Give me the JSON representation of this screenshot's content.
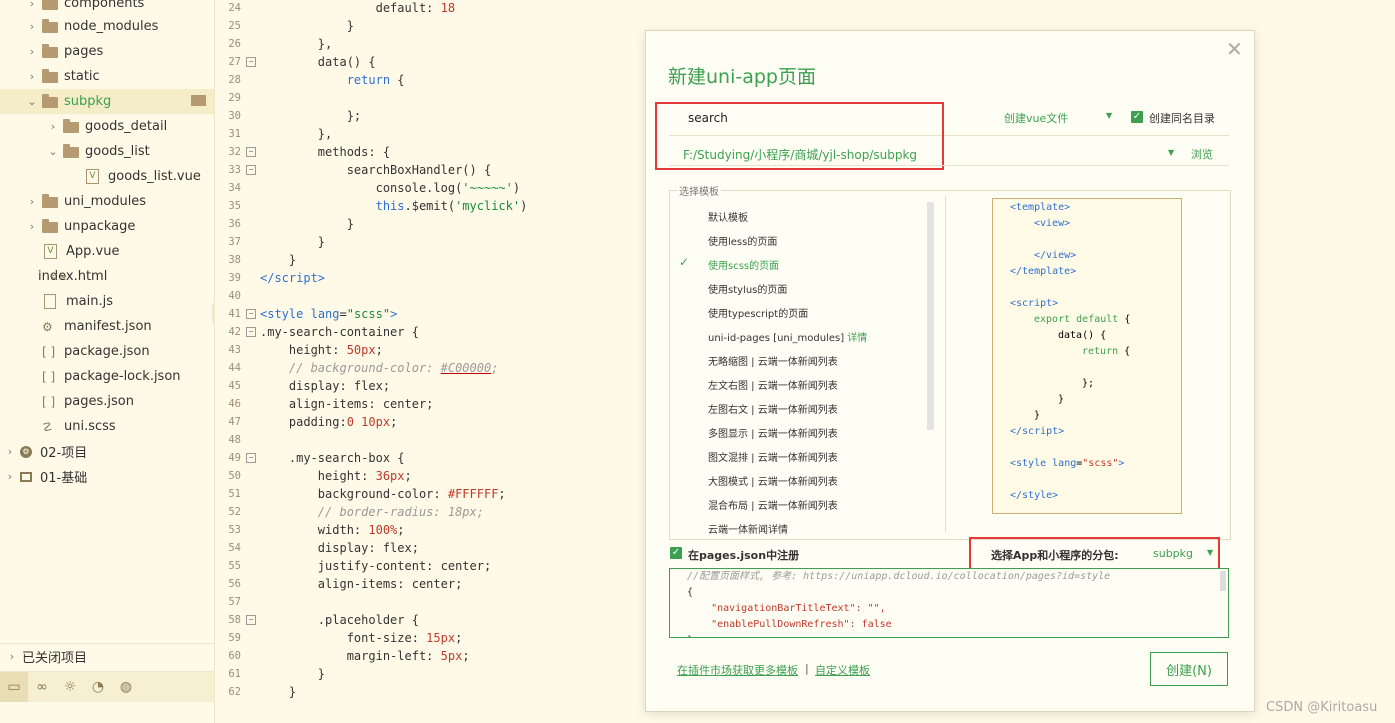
{
  "sidebar": {
    "items": [
      {
        "label": "components",
        "type": "folder",
        "depth": 1,
        "chevron": "›"
      },
      {
        "label": "node_modules",
        "type": "folder",
        "depth": 1,
        "chevron": "›"
      },
      {
        "label": "pages",
        "type": "folder",
        "depth": 1,
        "chevron": "›"
      },
      {
        "label": "static",
        "type": "folder",
        "depth": 1,
        "chevron": "›"
      },
      {
        "label": "subpkg",
        "type": "folder",
        "depth": 1,
        "chevron": "⌄",
        "selected": true
      },
      {
        "label": "goods_detail",
        "type": "folder",
        "depth": 2,
        "chevron": "›"
      },
      {
        "label": "goods_list",
        "type": "folder",
        "depth": 2,
        "chevron": "⌄"
      },
      {
        "label": "goods_list.vue",
        "type": "vue",
        "depth": 3,
        "chevron": ""
      },
      {
        "label": "uni_modules",
        "type": "folder",
        "depth": 1,
        "chevron": "›"
      },
      {
        "label": "unpackage",
        "type": "folder",
        "depth": 1,
        "chevron": "›"
      },
      {
        "label": "App.vue",
        "type": "vue",
        "depth": 1,
        "chevron": ""
      },
      {
        "label": "index.html",
        "type": "code",
        "depth": 1,
        "chevron": ""
      },
      {
        "label": "main.js",
        "type": "file",
        "depth": 1,
        "chevron": ""
      },
      {
        "label": "manifest.json",
        "type": "gear",
        "depth": 1,
        "chevron": ""
      },
      {
        "label": "package.json",
        "type": "brk",
        "depth": 1,
        "chevron": ""
      },
      {
        "label": "package-lock.json",
        "type": "brk",
        "depth": 1,
        "chevron": ""
      },
      {
        "label": "pages.json",
        "type": "brk",
        "depth": 1,
        "chevron": ""
      },
      {
        "label": "uni.scss",
        "type": "leaf",
        "depth": 1,
        "chevron": ""
      },
      {
        "label": "02-项目",
        "type": "proj",
        "depth": 0,
        "chevron": "›"
      },
      {
        "label": "01-基础",
        "type": "box",
        "depth": 0,
        "chevron": "›"
      }
    ],
    "closed_projects": "已关闭项目",
    "closed_chevron": "›"
  },
  "editor": {
    "lines": [
      {
        "n": "24",
        "html": "                default: <span class='num'>18</span>"
      },
      {
        "n": "25",
        "html": "            }"
      },
      {
        "n": "26",
        "html": "        },"
      },
      {
        "n": "27",
        "html": "        data() {",
        "fold": true
      },
      {
        "n": "28",
        "html": "            <span class='kw'>return</span> {"
      },
      {
        "n": "29",
        "html": ""
      },
      {
        "n": "30",
        "html": "            };"
      },
      {
        "n": "31",
        "html": "        },"
      },
      {
        "n": "32",
        "html": "        methods: {",
        "fold": true
      },
      {
        "n": "33",
        "html": "            searchBoxHandler() {",
        "fold": true
      },
      {
        "n": "34",
        "html": "                console.log(<span class='str'>'~~~~~'</span>)"
      },
      {
        "n": "35",
        "html": "                <span class='kw'>this</span>.$emit(<span class='str'>'myclick'</span>)"
      },
      {
        "n": "36",
        "html": "            }"
      },
      {
        "n": "37",
        "html": "        }"
      },
      {
        "n": "38",
        "html": "    }"
      },
      {
        "n": "39",
        "html": "<span class='tag'>&lt;/script&gt;</span>"
      },
      {
        "n": "40",
        "html": ""
      },
      {
        "n": "41",
        "html": "<span class='tag'>&lt;style</span> <span class='tag'>lang</span>=<span class='str'>\"scss\"</span><span class='tag'>&gt;</span>",
        "fold": true
      },
      {
        "n": "42",
        "html": ".my-search-container {",
        "fold": true
      },
      {
        "n": "43",
        "html": "    height: <span class='num'>50px</span>;"
      },
      {
        "n": "44",
        "html": "    <span class='cmt'>// background-color: <span style='text-decoration:underline;text-decoration-color:#c00000;'>#C00000</span>;</span>"
      },
      {
        "n": "45",
        "html": "    display: flex;"
      },
      {
        "n": "46",
        "html": "    align-items: center;"
      },
      {
        "n": "47",
        "html": "    padding:<span class='num'>0</span> <span class='num'>10px</span>;"
      },
      {
        "n": "48",
        "html": ""
      },
      {
        "n": "49",
        "html": "    .my-search-box {",
        "fold": true
      },
      {
        "n": "50",
        "html": "        height: <span class='num'>36px</span>;"
      },
      {
        "n": "51",
        "html": "        background-color: <span class='num'>#FFFFFF</span>;"
      },
      {
        "n": "52",
        "html": "        <span class='cmt'>// border-radius: 18px;</span>"
      },
      {
        "n": "53",
        "html": "        width: <span class='num'>100%</span>;"
      },
      {
        "n": "54",
        "html": "        display: flex;"
      },
      {
        "n": "55",
        "html": "        justify-content: center;"
      },
      {
        "n": "56",
        "html": "        align-items: center;"
      },
      {
        "n": "57",
        "html": ""
      },
      {
        "n": "58",
        "html": "        .placeholder {",
        "fold": true
      },
      {
        "n": "59",
        "html": "            font-size: <span class='num'>15px</span>;"
      },
      {
        "n": "60",
        "html": "            margin-left: <span class='num'>5px</span>;"
      },
      {
        "n": "61",
        "html": "        }"
      },
      {
        "n": "62",
        "html": "    }"
      }
    ]
  },
  "dialog": {
    "title": "新建uni-app页面",
    "close": "✕",
    "name_value": "search",
    "vue_type": "创建vue文件",
    "same_dir_label": "创建同名目录",
    "path": "F:/Studying/小程序/商城/yjl-shop/subpkg",
    "browse": "浏览",
    "template_legend": "选择模板",
    "templates": [
      "默认模板",
      "使用less的页面",
      "使用scss的页面",
      "使用stylus的页面",
      "使用typescript的页面",
      "uni-id-pages [uni_modules] 详情",
      "无略缩图 | 云端一体新闻列表",
      "左文右图 | 云端一体新闻列表",
      "左图右文 | 云端一体新闻列表",
      "多图显示 | 云端一体新闻列表",
      "图文混排 | 云端一体新闻列表",
      "大图模式 | 云端一体新闻列表",
      "混合布局 | 云端一体新闻列表",
      "云端一体新闻详情"
    ],
    "selected_template": "使用scss的页面",
    "register_label": "在pages.json中注册",
    "subpkg_label": "选择App和小程序的分包:",
    "subpkg_value": "subpkg",
    "json_lines": [
      "//配置页面样式, 参考: https://uniapp.dcloud.io/collocation/pages?id=style",
      "{",
      "    \"navigationBarTitleText\": \"\",",
      "    \"enablePullDownRefresh\": false",
      "}"
    ],
    "market_link": "在插件市场获取更多模板",
    "link_sep": "|",
    "custom_link": "自定义模板",
    "create_button": "创建(N)"
  },
  "watermark": "CSDN @Kiritoasu",
  "colors": {
    "accent_green": "#3ca050",
    "highlight_red": "#e53935",
    "background": "#fffae8"
  }
}
